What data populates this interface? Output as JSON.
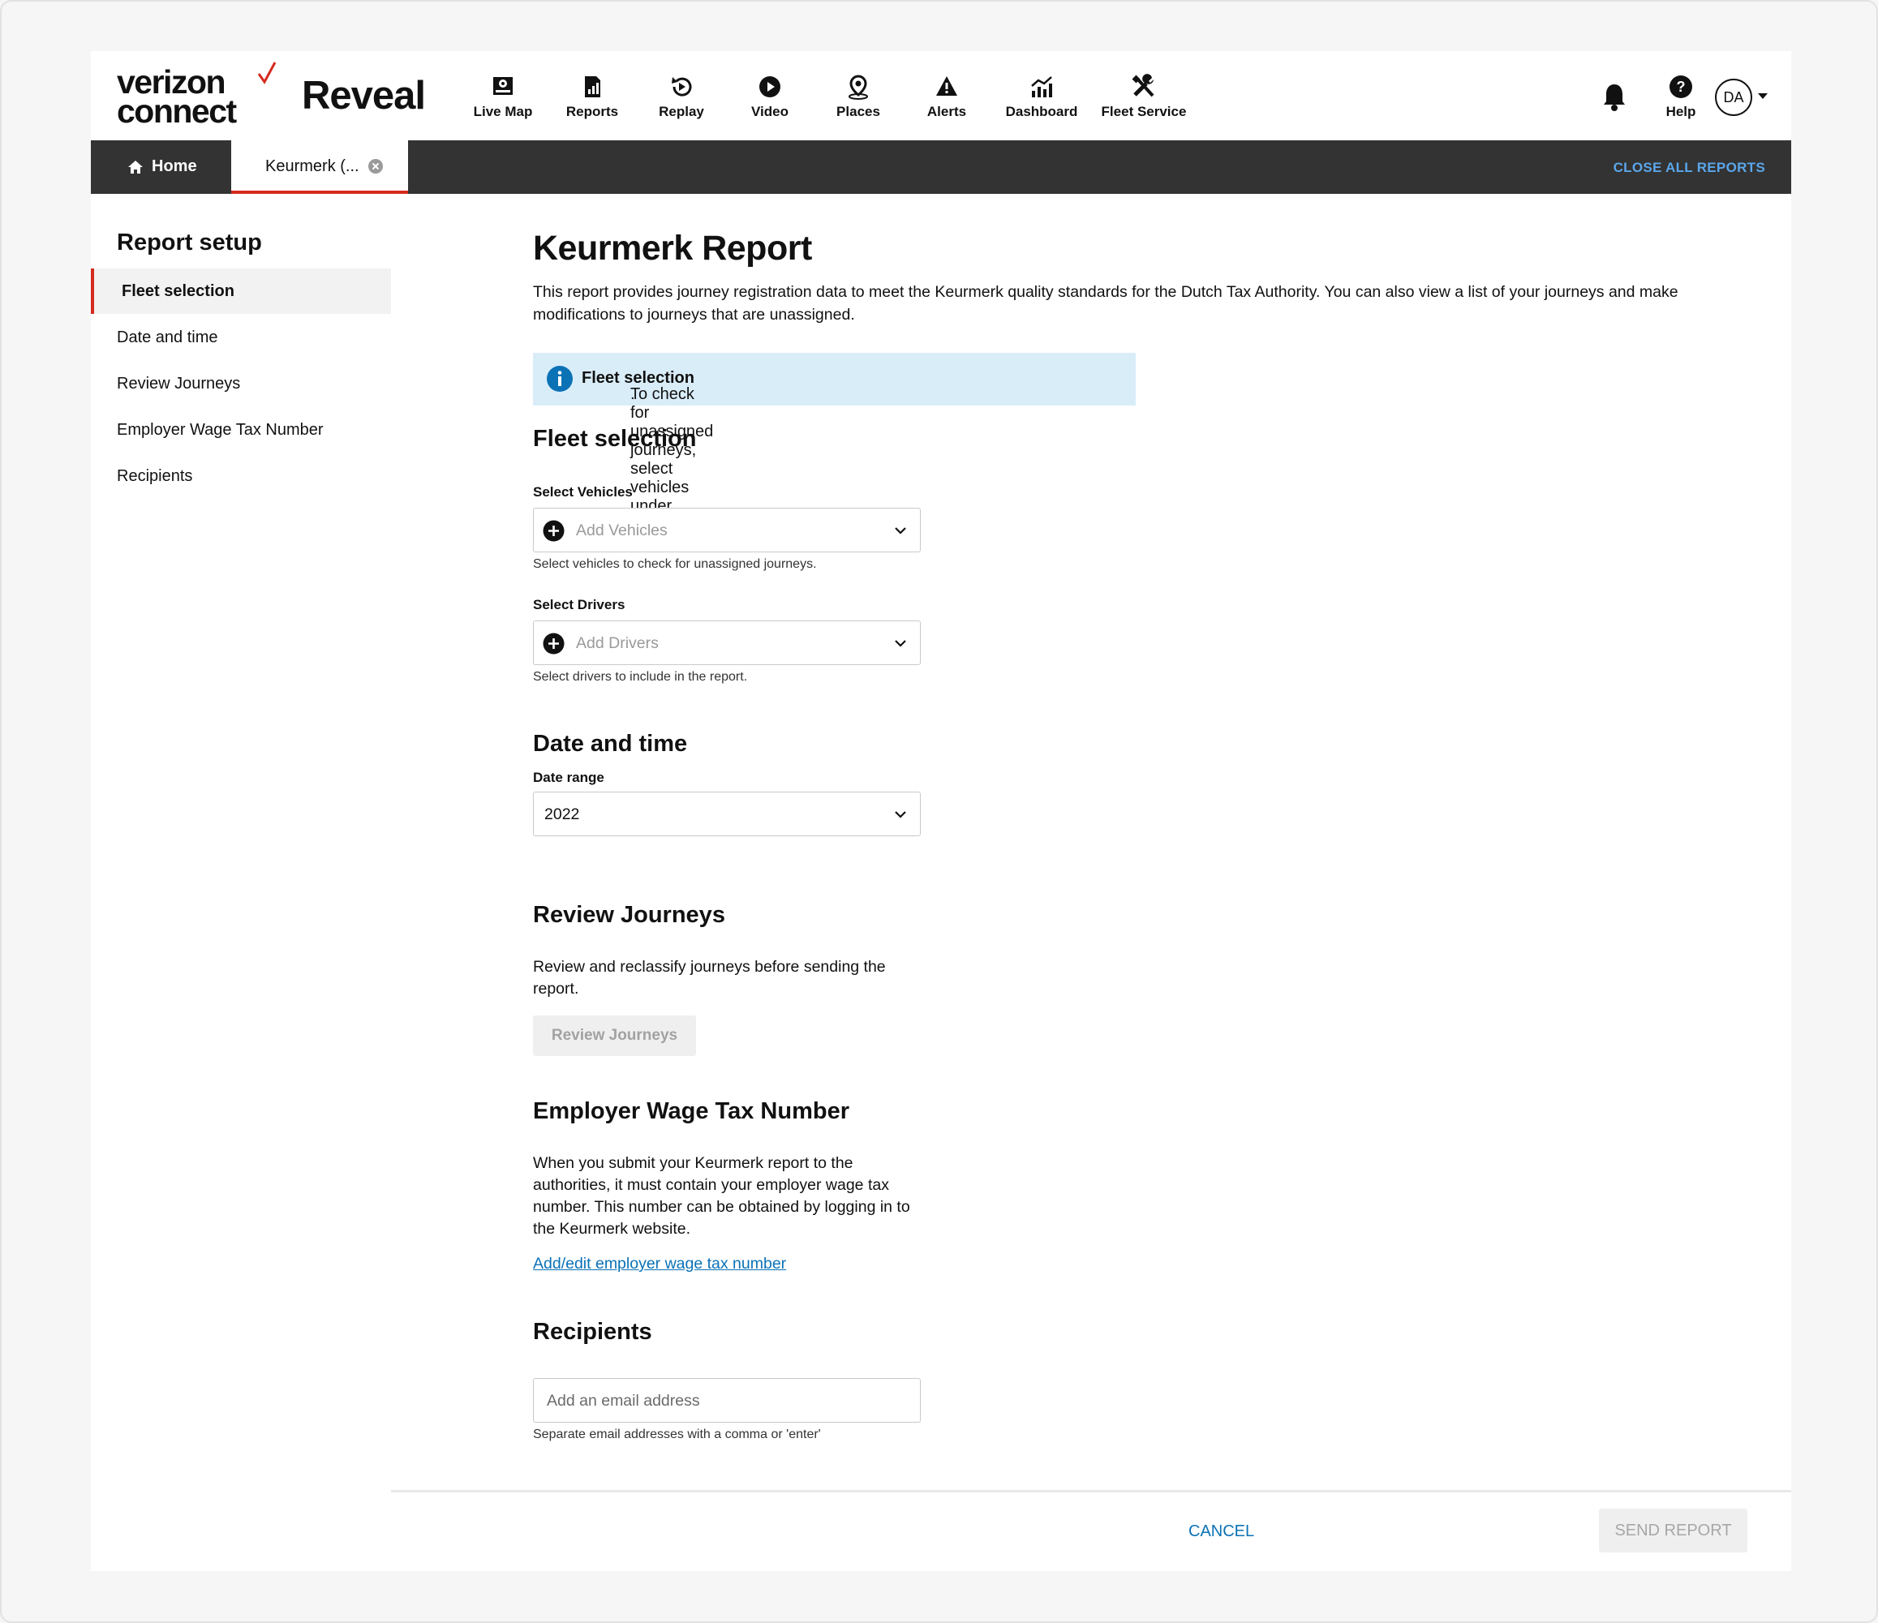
{
  "brand": {
    "logo_line1": "verizon",
    "logo_line2": "connect",
    "product": "Reveal",
    "accent": "#d52b1e"
  },
  "nav": {
    "items": [
      {
        "label": "Live Map",
        "icon": "live-map-icon"
      },
      {
        "label": "Reports",
        "icon": "reports-icon"
      },
      {
        "label": "Replay",
        "icon": "replay-icon"
      },
      {
        "label": "Video",
        "icon": "video-icon"
      },
      {
        "label": "Places",
        "icon": "places-icon"
      },
      {
        "label": "Alerts",
        "icon": "alerts-icon"
      },
      {
        "label": "Dashboard",
        "icon": "dashboard-icon"
      },
      {
        "label": "Fleet Service",
        "icon": "fleet-service-icon"
      }
    ],
    "help_label": "Help",
    "avatar_initials": "DA"
  },
  "tabs": {
    "home_label": "Home",
    "report_tab_label": "Keurmerk (...",
    "close_all_label": "CLOSE ALL REPORTS"
  },
  "sidebar": {
    "title": "Report setup",
    "items": [
      {
        "label": "Fleet selection",
        "active": true
      },
      {
        "label": "Date and time",
        "active": false
      },
      {
        "label": "Review Journeys",
        "active": false
      },
      {
        "label": "Employer Wage Tax Number",
        "active": false
      },
      {
        "label": "Recipients",
        "active": false
      }
    ]
  },
  "main": {
    "title": "Keurmerk Report",
    "description": "This report provides journey registration data to meet the Keurmerk quality standards for the Dutch Tax Authority. You can also view a list of your journeys and make modifications to journeys that are unassigned.",
    "info_prefix": "To check for unassigned journeys, select vehicles under ",
    "info_bold": "Fleet selection",
    "info_suffix": ".",
    "fleet": {
      "heading": "Fleet selection",
      "vehicles_label": "Select Vehicles",
      "vehicles_placeholder": "Add Vehicles",
      "vehicles_help": "Select vehicles to check for unassigned journeys.",
      "drivers_label": "Select Drivers",
      "drivers_placeholder": "Add Drivers",
      "drivers_help": "Select drivers to include in the report."
    },
    "datetime": {
      "heading": "Date and time",
      "range_label": "Date range",
      "range_value": "2022"
    },
    "review": {
      "heading": "Review Journeys",
      "text": "Review and reclassify journeys before sending the report.",
      "button": "Review Journeys"
    },
    "wage": {
      "heading": "Employer Wage Tax Number",
      "text": "When you submit your Keurmerk report to the authorities, it must contain your employer wage tax number. This number can be obtained by logging in to the Keurmerk website.",
      "link": "Add/edit employer wage tax number"
    },
    "recipients": {
      "heading": "Recipients",
      "placeholder": "Add an email address",
      "help": "Separate email addresses with a comma or 'enter'"
    }
  },
  "footer": {
    "cancel": "CANCEL",
    "send": "SEND REPORT"
  }
}
